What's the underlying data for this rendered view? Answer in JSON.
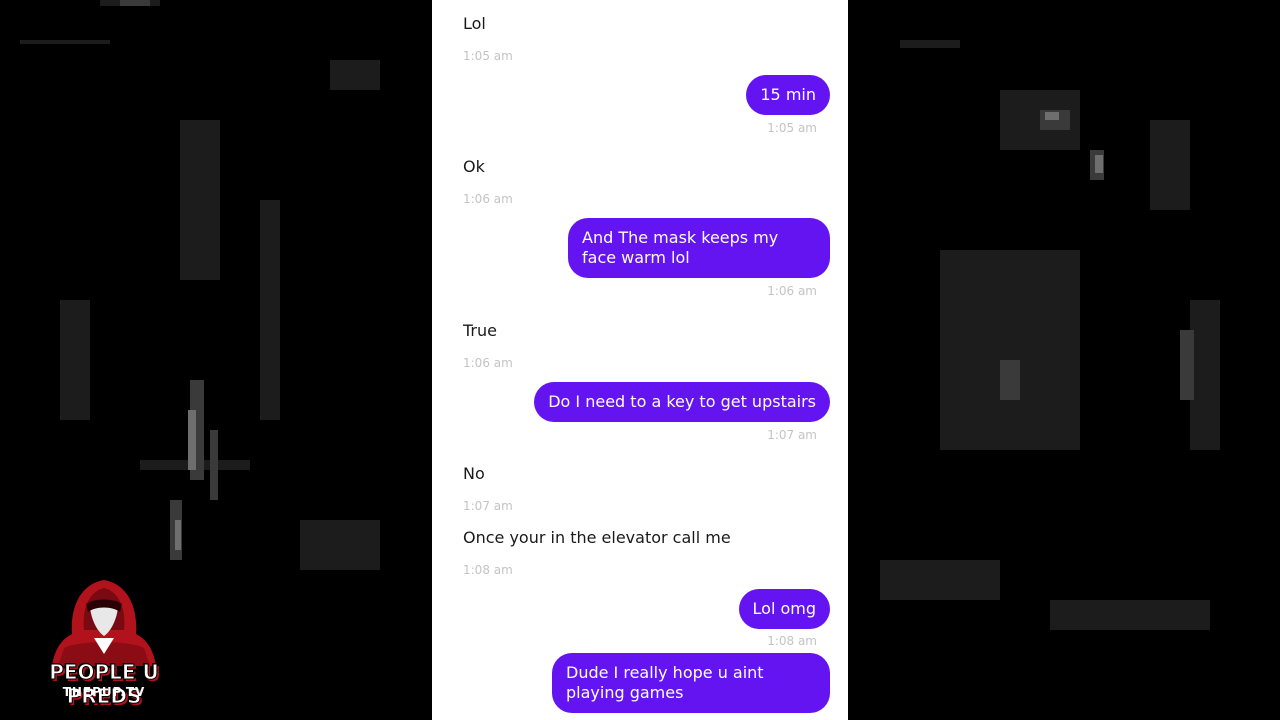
{
  "conversation": {
    "messages": [
      {
        "side": "in",
        "text": "Lol",
        "time": "1:05 am"
      },
      {
        "side": "out",
        "text": "15 min",
        "time": "1:05 am"
      },
      {
        "side": "in",
        "text": "Ok",
        "time": "1:06 am"
      },
      {
        "side": "out",
        "text": "And The mask keeps my face warm lol",
        "time": "1:06 am"
      },
      {
        "side": "in",
        "text": "True",
        "time": "1:06 am"
      },
      {
        "side": "out",
        "text": "Do I need to a key to get upstairs",
        "time": "1:07 am"
      },
      {
        "side": "in",
        "text": "No",
        "time": "1:07 am"
      },
      {
        "side": "in",
        "text": "Once your in the elevator call me",
        "time": "1:08 am"
      },
      {
        "side": "out",
        "text": "Lol omg",
        "time": "1:08 am"
      },
      {
        "side": "out",
        "text": "Dude I really hope u aint playing games",
        "time": ""
      }
    ]
  },
  "watermark": {
    "title": "PEOPLE U PREDS",
    "subtitle": "THEPUP.TV"
  },
  "colors": {
    "outgoing_bubble": "#6413f1",
    "timestamp": "#c4c4c4",
    "logo_red": "#b1121c"
  },
  "icons": {
    "logo": "hooded-figure-icon"
  }
}
